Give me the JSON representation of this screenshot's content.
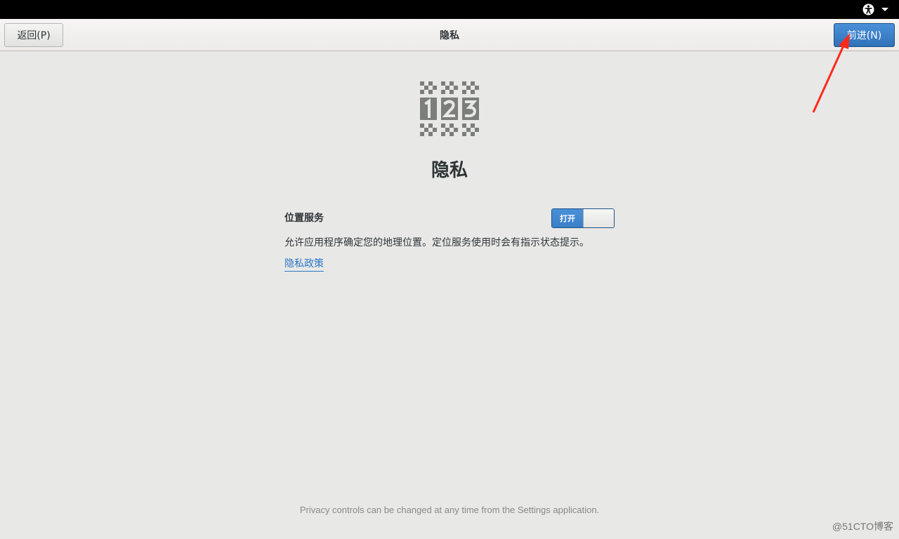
{
  "topbar": {
    "accessibility_icon": "accessibility-icon",
    "menu_icon": "chevron-down-icon"
  },
  "header": {
    "back_label": "返回(P)",
    "title": "隐私",
    "next_label": "前进(N)"
  },
  "main": {
    "logo_icon": "privacy-123-icon",
    "heading": "隐私",
    "location": {
      "label": "位置服务",
      "toggle_state": "打开",
      "description": "允许应用程序确定您的地理位置。定位服务使用时会有指示状态提示。"
    },
    "policy_link": "隐私政策"
  },
  "footer": {
    "note": "Privacy controls can be changed at any time from the Settings application."
  },
  "watermark": "@51CTO博客",
  "colors": {
    "accent": "#4a90d9",
    "annotation": "#ff2a1a",
    "background": "#e8e8e7"
  }
}
